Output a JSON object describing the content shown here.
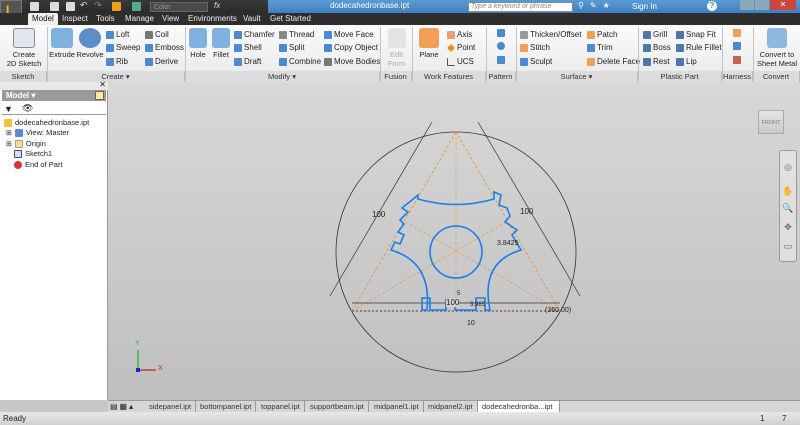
{
  "window": {
    "title": "dodecahedronbase.ipt",
    "search_placeholder": "Type a keyword or phrase",
    "sign_in": "Sign In",
    "help": "?",
    "color_select": "Color",
    "fx": "fx"
  },
  "tabs": [
    "Model",
    "Inspect",
    "Tools",
    "Manage",
    "View",
    "Environments",
    "Vault",
    "Get Started"
  ],
  "ribbon": {
    "sketch": {
      "label": "Sketch",
      "create_2d": "Create\n2D Sketch"
    },
    "create": {
      "label": "Create ▾",
      "extrude": "Extrude",
      "revolve": "Revolve",
      "loft": "Loft",
      "sweep": "Sweep",
      "rib": "Rib",
      "coil": "Coil",
      "emboss": "Emboss",
      "derive": "Derive"
    },
    "modify": {
      "label": "Modify ▾",
      "hole": "Hole",
      "fillet": "Fillet",
      "chamfer": "Chamfer",
      "shell": "Shell",
      "draft": "Draft",
      "thread": "Thread",
      "split": "Split",
      "combine": "Combine",
      "move_face": "Move Face",
      "copy_object": "Copy Object",
      "move_bodies": "Move Bodies"
    },
    "fusion": {
      "label": "Fusion",
      "edit_form": "Edit Form"
    },
    "work_features": {
      "label": "Work Features",
      "plane": "Plane",
      "axis": "Axis",
      "point": "Point",
      "ucs": "UCS"
    },
    "pattern": {
      "label": "Pattern"
    },
    "surface": {
      "label": "Surface ▾",
      "thicken": "Thicken/Offset",
      "stitch": "Stitch",
      "sculpt": "Sculpt",
      "patch": "Patch",
      "trim": "Trim",
      "delete_face": "Delete Face"
    },
    "plastic": {
      "label": "Plastic Part",
      "grill": "Grill",
      "boss": "Boss",
      "rest": "Rest",
      "snap_fit": "Snap Fit",
      "rule_fillet": "Rule Fillet",
      "lip": "Lip"
    },
    "harness": {
      "label": "Harness"
    },
    "convert": {
      "label": "Convert",
      "sheet_metal": "Convert to Sheet Metal"
    }
  },
  "browser": {
    "title": "Model ▾",
    "tree": [
      "dodecahedronbase.ipt",
      "View: Master",
      "Origin",
      "Sketch1",
      "End of Part"
    ]
  },
  "sketch": {
    "dims": {
      "left": "100",
      "right": "100",
      "bottom": "100",
      "small": "5",
      "ten": "10",
      "angle": "(360.00)",
      "r": "3.8425",
      "tiny": "3.985"
    }
  },
  "viewcube": "FRONT",
  "axes": {
    "x": "X",
    "y": "Y"
  },
  "doc_tabs": [
    "sidepanel.ipt",
    "bottompanel.ipt",
    "toppanel.ipt",
    "supportbeam.ipt",
    "midpanel1.ipt",
    "midpanel2.ipt",
    "dodecahedronba...ipt"
  ],
  "status": {
    "text": "Ready",
    "count1": "1",
    "count2": "7"
  },
  "colors": {
    "accent": "#3f7fc0",
    "sketch_blue": "#1a7fe8",
    "construction": "#f08a24"
  }
}
